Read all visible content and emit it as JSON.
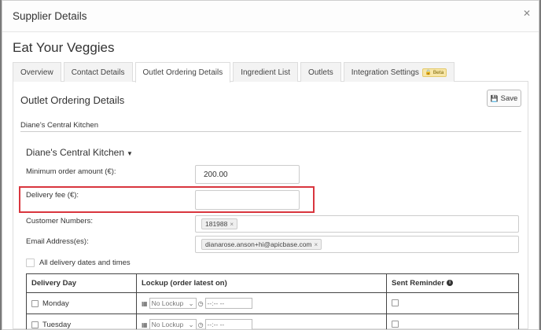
{
  "modal": {
    "title": "Supplier Details",
    "close_glyph": "✕"
  },
  "supplier_name": "Eat Your Veggies",
  "tabs": [
    {
      "label": "Overview"
    },
    {
      "label": "Contact Details"
    },
    {
      "label": "Outlet Ordering Details",
      "active": true
    },
    {
      "label": "Ingredient List"
    },
    {
      "label": "Outlets"
    },
    {
      "label": "Integration Settings",
      "badge": "Beta"
    }
  ],
  "panel": {
    "title": "Outlet Ordering Details",
    "save_label": "Save",
    "kitchen_label": "Diane's Central Kitchen",
    "group_title": "Diane's Central Kitchen"
  },
  "form": {
    "min_order_label": "Minimum order amount (€):",
    "min_order_value": "200.00",
    "delivery_fee_label": "Delivery fee (€):",
    "delivery_fee_value": "",
    "customer_numbers_label": "Customer Numbers:",
    "customer_numbers": [
      "181988"
    ],
    "email_label": "Email Address(es):",
    "emails": [
      "dianarose.anson+hi@apicbase.com"
    ],
    "all_delivery_label": "All delivery dates and times"
  },
  "table": {
    "headers": {
      "day": "Delivery Day",
      "lockup": "Lockup (order latest on)",
      "reminder": "Sent Reminder"
    },
    "rows": [
      {
        "day": "Monday",
        "lockup_select": "No Lockup",
        "time": "--:-- --"
      },
      {
        "day": "Tuesday",
        "lockup_select": "No Lockup",
        "time": "--:-- --"
      }
    ]
  },
  "icons": {
    "save": "save-icon",
    "calendar": "calendar-icon",
    "clock": "clock-icon",
    "info": "info-icon"
  },
  "colors": {
    "highlight": "#d9363e"
  }
}
